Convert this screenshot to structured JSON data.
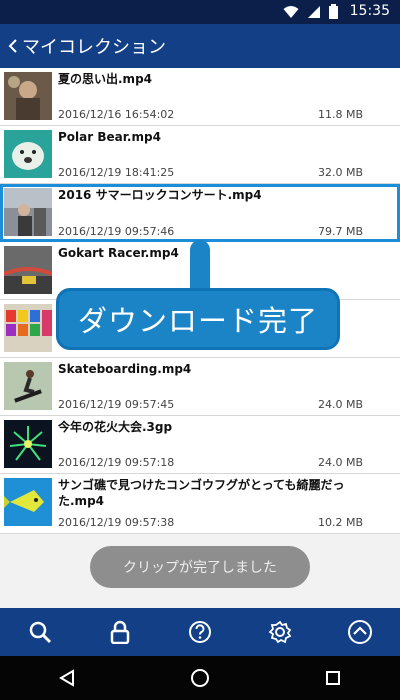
{
  "status_bar": {
    "time": "15:35",
    "wifi_icon": "wifi-icon",
    "signal_icon": "signal-icon",
    "battery_icon": "battery-icon"
  },
  "app_bar": {
    "title": "マイコレクション",
    "back_icon": "chevron-left-icon"
  },
  "items": [
    {
      "name": "夏の思い出.mp4",
      "date": "2016/12/16 16:54:02",
      "size": "11.8 MB"
    },
    {
      "name": "Polar Bear.mp4",
      "date": "2016/12/19 18:41:25",
      "size": "32.0 MB"
    },
    {
      "name": "2016 サマーロックコンサート.mp4",
      "date": "2016/12/19 09:57:46",
      "size": "79.7 MB"
    },
    {
      "name": "Gokart Racer.mp4",
      "date": "",
      "size": ""
    },
    {
      "name": "",
      "date": "",
      "size": ""
    },
    {
      "name": "Skateboarding.mp4",
      "date": "2016/12/19 09:57:45",
      "size": "24.0 MB"
    },
    {
      "name": "今年の花火大会.3gp",
      "date": "2016/12/19 09:57:18",
      "size": "24.0 MB"
    },
    {
      "name": "サンゴ礁で見つけたコンゴウフグがとっても綺麗だった.mp4",
      "date": "2016/12/19 09:57:38",
      "size": "10.2 MB"
    }
  ],
  "callout": {
    "text": "ダウンロード完了"
  },
  "toast": {
    "text": "クリップが完了しました"
  },
  "toolbar": {
    "search_icon": "search-icon",
    "lock_icon": "lock-icon",
    "help_icon": "help-icon",
    "settings_icon": "gear-icon",
    "up_icon": "chevron-up-circle-icon"
  },
  "nav_bar": {
    "back_icon": "triangle-back-icon",
    "home_icon": "circle-home-icon",
    "recents_icon": "square-recents-icon"
  },
  "colors": {
    "app_bar": "#123f86",
    "status_bar": "#0b1f4a",
    "accent": "#1c8ed9",
    "callout": "#1b84c7"
  }
}
